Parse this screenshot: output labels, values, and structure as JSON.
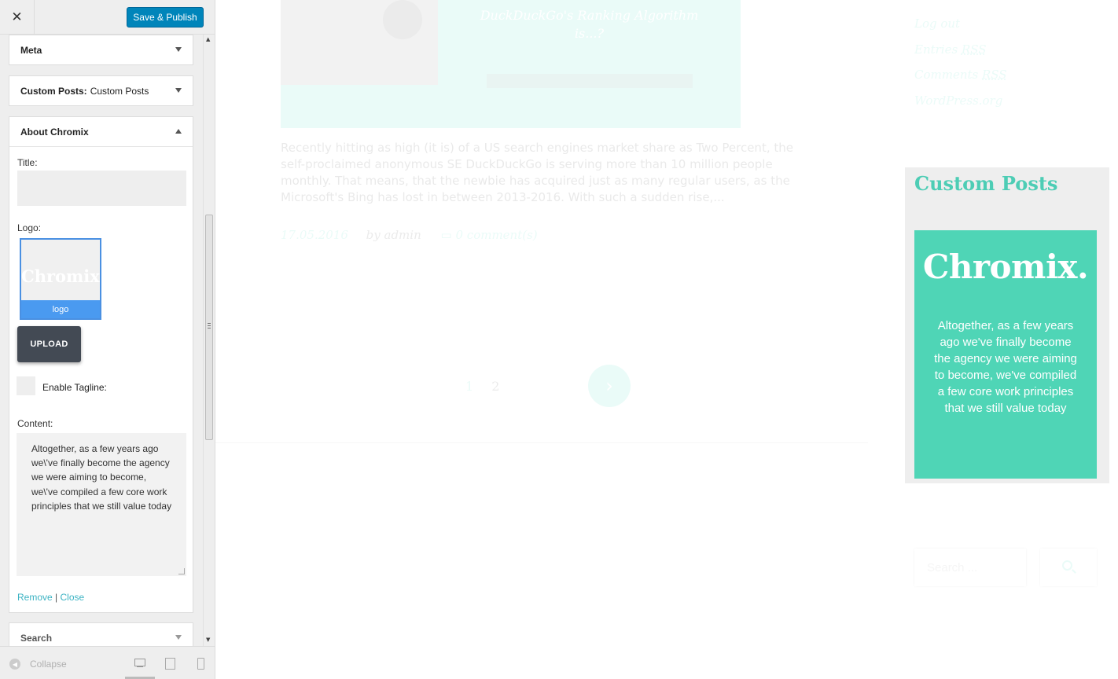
{
  "topbar": {
    "close_glyph": "✕",
    "publish_label": "Save & Publish"
  },
  "sections": {
    "meta": {
      "title": "Meta"
    },
    "custom_posts": {
      "title": "Custom Posts:",
      "subtitle": "Custom Posts"
    },
    "about": {
      "title": "About Chromix",
      "title_label": "Title:",
      "title_value": "",
      "logo_label": "Logo:",
      "logo_image_text": "Chromix.",
      "logo_caption": "logo",
      "upload_label": "UPLOAD",
      "tagline_label": "Enable Tagline:",
      "tagline_checked": false,
      "content_label": "Content:",
      "content_value": "Altogether, as a few years ago we\\'ve finally become the agency we were aiming to become, we\\'ve compiled a few core work principles that we still value today",
      "remove_label": "Remove",
      "link_separator": "|",
      "close_label": "Close"
    },
    "search": {
      "title": "Search"
    }
  },
  "footer": {
    "collapse_label": "Collapse",
    "collapse_glyph": "◀",
    "devices": [
      "desktop-icon",
      "tablet-icon",
      "mobile-icon"
    ],
    "active_device": "desktop"
  },
  "preview": {
    "audio_title": "DuckDuckGo's Ranking Algorithm is...?",
    "excerpt": "Recently hitting as high (it is) of a US search engines market share as Two Percent, the self-proclaimed anonymous SE DuckDuckGo is serving more than 10 million people monthly. That means, that the newbie has acquired just as many regular users, as the Microsoft's Bing has lost in between 2013-2016. With such a sudden rise,...",
    "date": "17.05.2016",
    "author": "by admin",
    "comments": "0 comment(s)",
    "pages": [
      "1",
      "2"
    ],
    "next_glyph": "›",
    "meta_links": [
      {
        "text": "Log out",
        "abbr": ""
      },
      {
        "text": "Entries ",
        "abbr": "RSS"
      },
      {
        "text": "Comments ",
        "abbr": "RSS"
      },
      {
        "text": "WordPress.org",
        "abbr": ""
      }
    ],
    "widget": {
      "title": "Custom Posts",
      "logo_text": "Chromix.",
      "text": "Altogether, as a few years ago we've finally become the agency we were aiming to become, we've compiled a few core work principles that we still value today"
    },
    "search_placeholder": "Search ..."
  },
  "colors": {
    "accent": "#2fd0b3",
    "card": "#4fd5b6",
    "publish": "#0085ba",
    "upload": "#434a54",
    "logo_caption": "#4a9af0"
  }
}
